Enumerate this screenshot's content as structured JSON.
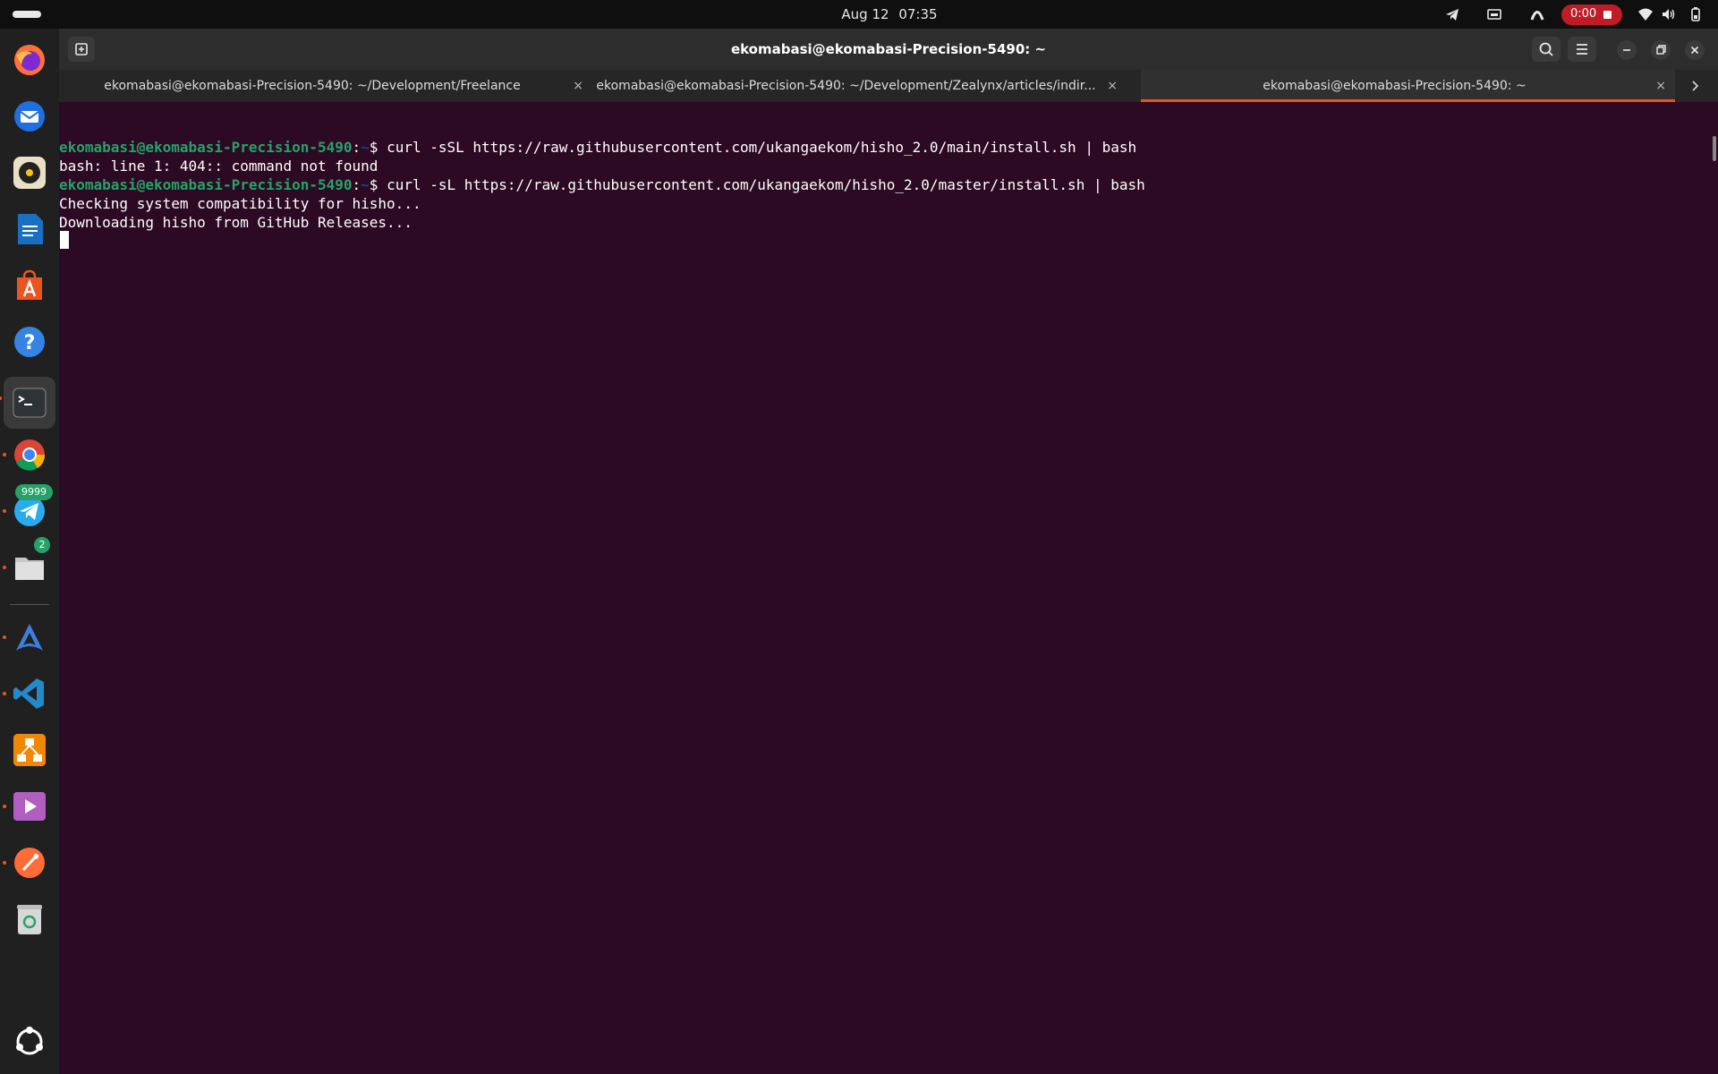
{
  "topbar": {
    "clock_date": "Aug 12",
    "clock_time": "07:35",
    "recording_time": "0:00",
    "tray_icons": [
      "telegram-icon",
      "screen-icon",
      "network-arc-icon",
      "wifi-icon",
      "volume-icon",
      "battery-icon"
    ]
  },
  "dock": {
    "items": [
      "firefox-icon",
      "thunderbird-icon",
      "rhythmbox-icon",
      "writer-icon",
      "app-center-icon",
      "help-icon",
      "terminal-icon",
      "chrome-icon",
      "telegram-icon",
      "files-icon",
      "arch-like-app-icon",
      "vscode-icon",
      "diagram-app-icon",
      "media-player-icon",
      "postman-icon",
      "trash-icon",
      "show-apps-icon"
    ],
    "telegram_badge": "9999",
    "files_badge": "2"
  },
  "window": {
    "title": "ekomabasi@ekomabasi-Precision-5490: ~",
    "tabs": [
      {
        "label": "ekomabasi@ekomabasi-Precision-5490: ~/Development/Freelance"
      },
      {
        "label": "ekomabasi@ekomabasi-Precision-5490: ~/Development/Zealynx/articles/indir..."
      },
      {
        "label": "ekomabasi@ekomabasi-Precision-5490: ~"
      }
    ],
    "close_glyph": "×"
  },
  "terminal": {
    "prompt_user": "ekomabasi@ekomabasi-Precision-5490",
    "prompt_sep": ":",
    "prompt_dir": "~",
    "prompt_end": "$ ",
    "cmd1": "curl -sSL https://raw.githubusercontent.com/ukangaekom/hisho_2.0/main/install.sh | bash",
    "out1": "bash: line 1: 404:: command not found",
    "cmd2": "curl -sL https://raw.githubusercontent.com/ukangaekom/hisho_2.0/master/install.sh | bash",
    "out2": "Checking system compatibility for hisho...",
    "out3": "Downloading hisho from GitHub Releases..."
  },
  "colors": {
    "terminal_bg": "#2c0a23",
    "prompt_user": "#26a269",
    "prompt_dir": "#12488b",
    "accent": "#e95420",
    "recording": "#c01c28"
  }
}
